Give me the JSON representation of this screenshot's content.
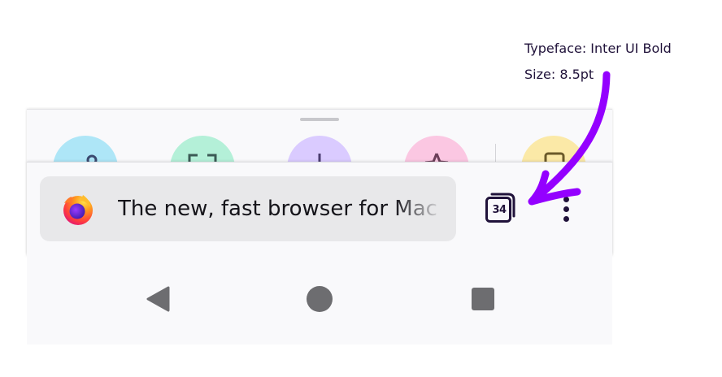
{
  "annotation": {
    "typeface": "Typeface: Inter UI Bold",
    "size": "Size: 8.5pt",
    "color": "#9400ff"
  },
  "sheet": {
    "shortcuts": [
      {
        "icon": "share-icon",
        "color": "#aee6f7"
      },
      {
        "icon": "scan-icon",
        "color": "#b4f0d8"
      },
      {
        "icon": "download-icon",
        "color": "#dacbff"
      },
      {
        "icon": "bookmark-star-icon",
        "color": "#fbc7e2"
      },
      {
        "icon": "reading-icon",
        "color": "#fbe9a7"
      }
    ]
  },
  "toolbar": {
    "url_text": "The new, fast browser for Mac",
    "site_icon": "firefox-logo-icon",
    "tabs_count": "34",
    "menu_icon": "three-dot-menu-icon"
  },
  "nav_bar": {
    "back_icon": "back-triangle-icon",
    "home_icon": "home-circle-icon",
    "recents_icon": "recents-square-icon"
  }
}
